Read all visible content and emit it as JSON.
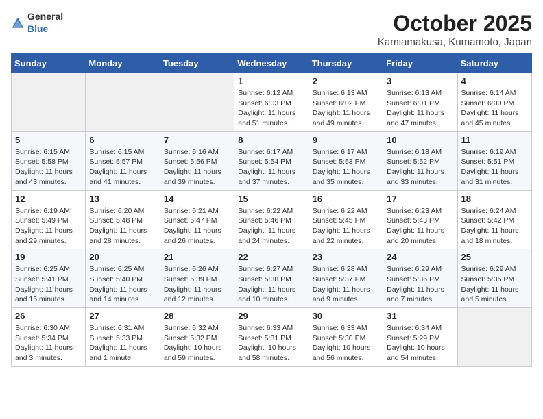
{
  "logo": {
    "general": "General",
    "blue": "Blue"
  },
  "title": "October 2025",
  "location": "Kamiamakusa, Kumamoto, Japan",
  "days_of_week": [
    "Sunday",
    "Monday",
    "Tuesday",
    "Wednesday",
    "Thursday",
    "Friday",
    "Saturday"
  ],
  "weeks": [
    [
      {
        "day": "",
        "content": ""
      },
      {
        "day": "",
        "content": ""
      },
      {
        "day": "",
        "content": ""
      },
      {
        "day": "1",
        "content": "Sunrise: 6:12 AM\nSunset: 6:03 PM\nDaylight: 11 hours\nand 51 minutes."
      },
      {
        "day": "2",
        "content": "Sunrise: 6:13 AM\nSunset: 6:02 PM\nDaylight: 11 hours\nand 49 minutes."
      },
      {
        "day": "3",
        "content": "Sunrise: 6:13 AM\nSunset: 6:01 PM\nDaylight: 11 hours\nand 47 minutes."
      },
      {
        "day": "4",
        "content": "Sunrise: 6:14 AM\nSunset: 6:00 PM\nDaylight: 11 hours\nand 45 minutes."
      }
    ],
    [
      {
        "day": "5",
        "content": "Sunrise: 6:15 AM\nSunset: 5:58 PM\nDaylight: 11 hours\nand 43 minutes."
      },
      {
        "day": "6",
        "content": "Sunrise: 6:15 AM\nSunset: 5:57 PM\nDaylight: 11 hours\nand 41 minutes."
      },
      {
        "day": "7",
        "content": "Sunrise: 6:16 AM\nSunset: 5:56 PM\nDaylight: 11 hours\nand 39 minutes."
      },
      {
        "day": "8",
        "content": "Sunrise: 6:17 AM\nSunset: 5:54 PM\nDaylight: 11 hours\nand 37 minutes."
      },
      {
        "day": "9",
        "content": "Sunrise: 6:17 AM\nSunset: 5:53 PM\nDaylight: 11 hours\nand 35 minutes."
      },
      {
        "day": "10",
        "content": "Sunrise: 6:18 AM\nSunset: 5:52 PM\nDaylight: 11 hours\nand 33 minutes."
      },
      {
        "day": "11",
        "content": "Sunrise: 6:19 AM\nSunset: 5:51 PM\nDaylight: 11 hours\nand 31 minutes."
      }
    ],
    [
      {
        "day": "12",
        "content": "Sunrise: 6:19 AM\nSunset: 5:49 PM\nDaylight: 11 hours\nand 29 minutes."
      },
      {
        "day": "13",
        "content": "Sunrise: 6:20 AM\nSunset: 5:48 PM\nDaylight: 11 hours\nand 28 minutes."
      },
      {
        "day": "14",
        "content": "Sunrise: 6:21 AM\nSunset: 5:47 PM\nDaylight: 11 hours\nand 26 minutes."
      },
      {
        "day": "15",
        "content": "Sunrise: 6:22 AM\nSunset: 5:46 PM\nDaylight: 11 hours\nand 24 minutes."
      },
      {
        "day": "16",
        "content": "Sunrise: 6:22 AM\nSunset: 5:45 PM\nDaylight: 11 hours\nand 22 minutes."
      },
      {
        "day": "17",
        "content": "Sunrise: 6:23 AM\nSunset: 5:43 PM\nDaylight: 11 hours\nand 20 minutes."
      },
      {
        "day": "18",
        "content": "Sunrise: 6:24 AM\nSunset: 5:42 PM\nDaylight: 11 hours\nand 18 minutes."
      }
    ],
    [
      {
        "day": "19",
        "content": "Sunrise: 6:25 AM\nSunset: 5:41 PM\nDaylight: 11 hours\nand 16 minutes."
      },
      {
        "day": "20",
        "content": "Sunrise: 6:25 AM\nSunset: 5:40 PM\nDaylight: 11 hours\nand 14 minutes."
      },
      {
        "day": "21",
        "content": "Sunrise: 6:26 AM\nSunset: 5:39 PM\nDaylight: 11 hours\nand 12 minutes."
      },
      {
        "day": "22",
        "content": "Sunrise: 6:27 AM\nSunset: 5:38 PM\nDaylight: 11 hours\nand 10 minutes."
      },
      {
        "day": "23",
        "content": "Sunrise: 6:28 AM\nSunset: 5:37 PM\nDaylight: 11 hours\nand 9 minutes."
      },
      {
        "day": "24",
        "content": "Sunrise: 6:29 AM\nSunset: 5:36 PM\nDaylight: 11 hours\nand 7 minutes."
      },
      {
        "day": "25",
        "content": "Sunrise: 6:29 AM\nSunset: 5:35 PM\nDaylight: 11 hours\nand 5 minutes."
      }
    ],
    [
      {
        "day": "26",
        "content": "Sunrise: 6:30 AM\nSunset: 5:34 PM\nDaylight: 11 hours\nand 3 minutes."
      },
      {
        "day": "27",
        "content": "Sunrise: 6:31 AM\nSunset: 5:33 PM\nDaylight: 11 hours\nand 1 minute."
      },
      {
        "day": "28",
        "content": "Sunrise: 6:32 AM\nSunset: 5:32 PM\nDaylight: 10 hours\nand 59 minutes."
      },
      {
        "day": "29",
        "content": "Sunrise: 6:33 AM\nSunset: 5:31 PM\nDaylight: 10 hours\nand 58 minutes."
      },
      {
        "day": "30",
        "content": "Sunrise: 6:33 AM\nSunset: 5:30 PM\nDaylight: 10 hours\nand 56 minutes."
      },
      {
        "day": "31",
        "content": "Sunrise: 6:34 AM\nSunset: 5:29 PM\nDaylight: 10 hours\nand 54 minutes."
      },
      {
        "day": "",
        "content": ""
      }
    ]
  ]
}
